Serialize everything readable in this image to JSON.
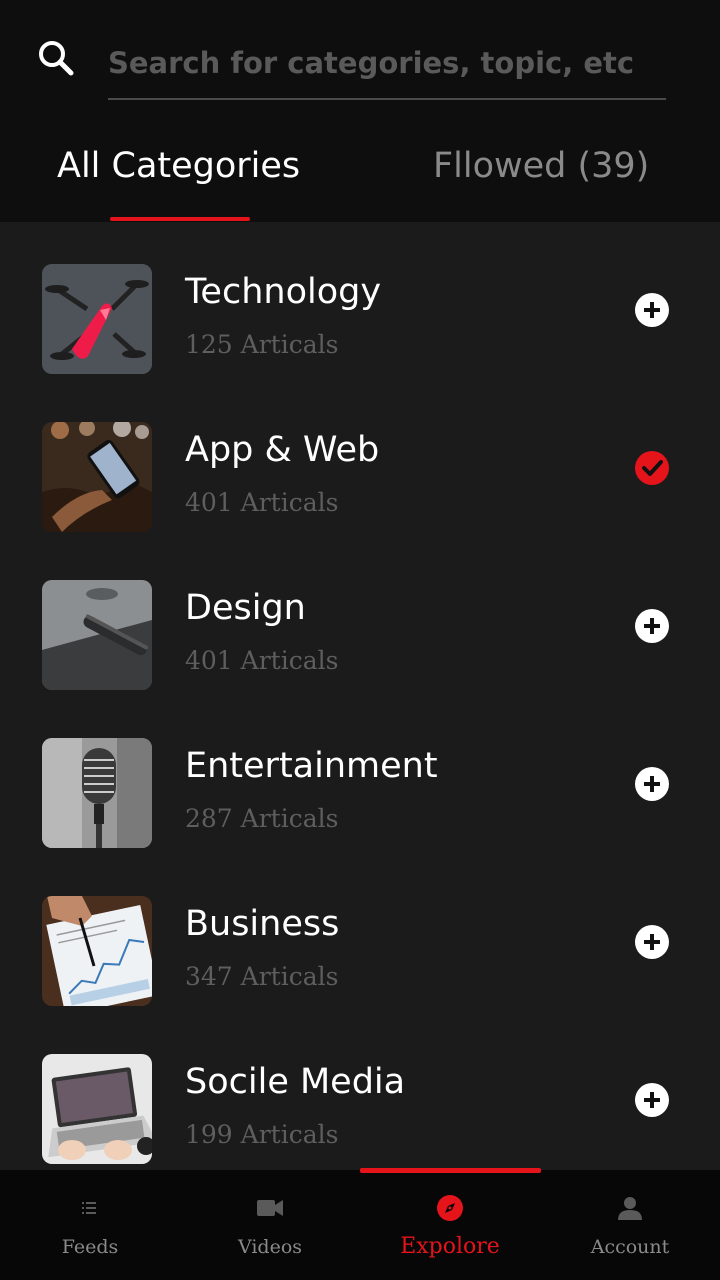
{
  "search": {
    "placeholder": "Search for categories, topic, etc"
  },
  "tabs": [
    {
      "label": "All Categories",
      "active": true
    },
    {
      "label": "Fllowed (39)",
      "active": false
    }
  ],
  "categories": [
    {
      "title": "Technology",
      "count": "125 Articals",
      "followed": false,
      "image": "drone-photo"
    },
    {
      "title": "App & Web",
      "count": "401 Articals",
      "followed": true,
      "image": "phone-in-hand-photo"
    },
    {
      "title": "Design",
      "count": "401 Articals",
      "followed": false,
      "image": "stylus-tablet-photo"
    },
    {
      "title": "Entertainment",
      "count": "287 Articals",
      "followed": false,
      "image": "microphone-photo"
    },
    {
      "title": "Business",
      "count": "347 Articals",
      "followed": false,
      "image": "charts-paper-photo"
    },
    {
      "title": "Socile Media",
      "count": "199 Articals",
      "followed": false,
      "image": "laptop-typing-photo"
    }
  ],
  "bottom_nav": [
    {
      "label": "Feeds",
      "icon": "list-icon",
      "active": false
    },
    {
      "label": "Videos",
      "icon": "videocam-icon",
      "active": false
    },
    {
      "label": "Expolore",
      "icon": "compass-icon",
      "active": true
    },
    {
      "label": "Account",
      "icon": "person-icon",
      "active": false
    }
  ],
  "colors": {
    "accent": "#e5141b",
    "header_bg": "#0e0e0e",
    "list_bg": "#1b1b1c",
    "nav_bg": "#070707",
    "muted_text": "#5e5e5e",
    "inactive_tab": "#8a8a8a"
  }
}
